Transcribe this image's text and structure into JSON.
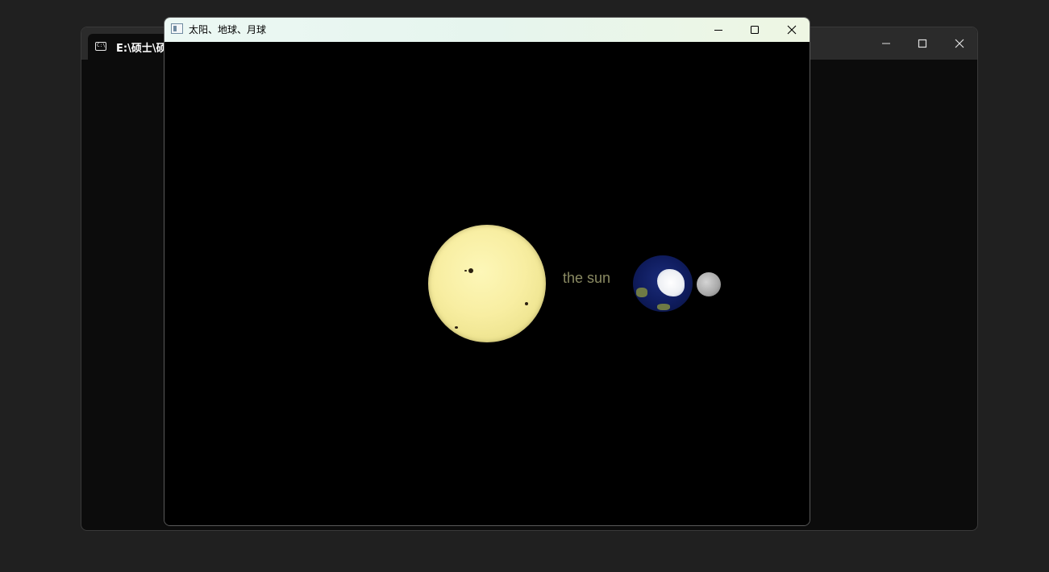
{
  "console_window": {
    "tab_title": "E:\\硕士\\硕",
    "tab_icon": "terminal-icon",
    "controls": {
      "minimize": "minimize-icon",
      "maximize": "maximize-icon",
      "close": "close-icon"
    }
  },
  "gl_window": {
    "title": "太阳、地球、月球",
    "app_icon": "window-icon",
    "controls": {
      "minimize": "minimize-icon",
      "maximize": "maximize-icon",
      "close": "close-icon"
    },
    "scene": {
      "sun_label": "the sun",
      "bodies": [
        "sun",
        "earth",
        "moon"
      ]
    }
  },
  "colors": {
    "desktop": "#202020",
    "console_bg": "#0c0c0c",
    "scene_bg": "#000000",
    "sun": "#f8eea2",
    "label": "#8a8a62",
    "earth_ocean": "#0f1c5e"
  }
}
